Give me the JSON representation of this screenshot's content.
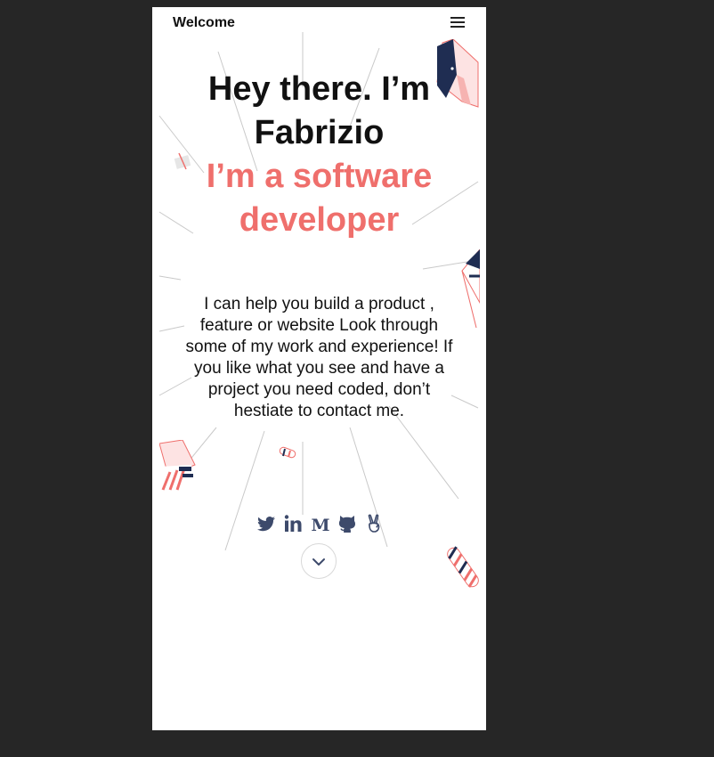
{
  "navbar": {
    "brand": "Welcome",
    "menu_icon": "hamburger-menu-icon"
  },
  "hero": {
    "title": "Hey there. I’m Fabrizio",
    "subtitle": "I’m a software developer",
    "intro": "I can help you build a product , feature or website Look through some of my work and experience! If you like what you see and have a project you need coded, don’t hestiate to contact me."
  },
  "socials": [
    {
      "icon": "twitter-icon"
    },
    {
      "icon": "linkedin-icon"
    },
    {
      "icon": "medium-icon"
    },
    {
      "icon": "github-icon"
    },
    {
      "icon": "angellist-icon"
    }
  ],
  "scroll_down": {
    "icon": "chevron-down-icon"
  },
  "colors": {
    "accent": "#ef6f6c",
    "navy": "#1f2d52",
    "icon": "#3d4a6b",
    "text": "#111111",
    "backdrop": "#262626"
  }
}
